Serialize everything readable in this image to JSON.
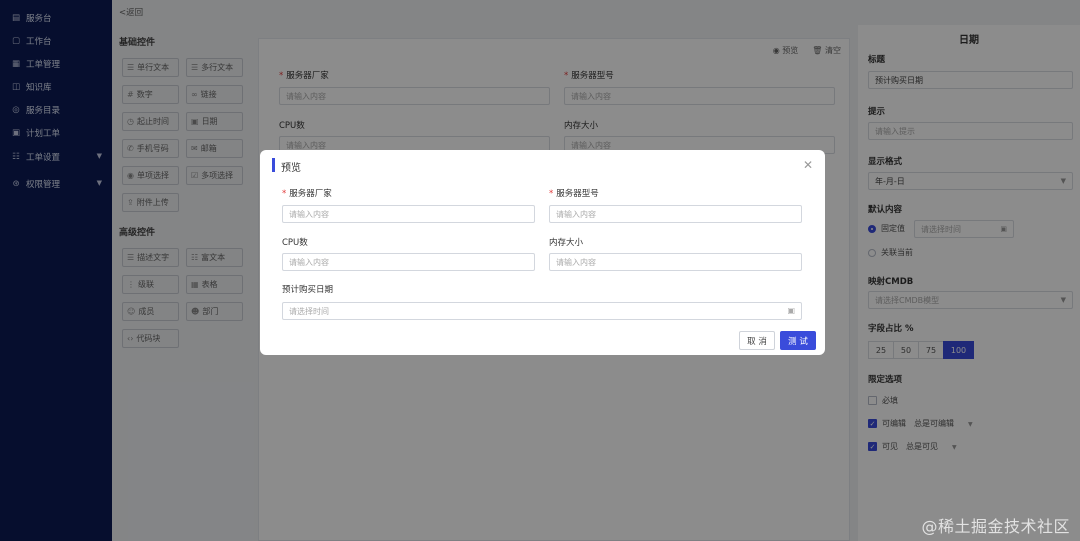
{
  "sidebar": {
    "items": [
      {
        "label": "服务台",
        "icon": "desk-icon"
      },
      {
        "label": "工作台",
        "icon": "workbench-icon"
      },
      {
        "label": "工单管理",
        "icon": "ticket-icon"
      },
      {
        "label": "知识库",
        "icon": "book-icon"
      },
      {
        "label": "服务目录",
        "icon": "catalog-icon"
      },
      {
        "label": "计划工单",
        "icon": "calendar-icon"
      },
      {
        "label": "工单设置",
        "icon": "settings-icon",
        "expandable": true
      },
      {
        "label": "权限管理",
        "icon": "shield-icon",
        "expandable": true
      }
    ]
  },
  "widgets": {
    "back_label": "返回",
    "basic_title": "基础控件",
    "basic": [
      "单行文本",
      "多行文本",
      "数字",
      "链接",
      "起止时间",
      "日期",
      "手机号码",
      "邮箱",
      "单项选择",
      "多项选择",
      "附件上传"
    ],
    "advanced_title": "高级控件",
    "advanced": [
      "描述文字",
      "富文本",
      "级联",
      "表格",
      "成员",
      "部门",
      "代码块"
    ]
  },
  "canvas": {
    "preview_label": "预览",
    "clear_label": "清空",
    "fields": [
      {
        "label": "服务器厂家",
        "required": true,
        "placeholder": "请输入内容"
      },
      {
        "label": "服务器型号",
        "required": true,
        "placeholder": "请输入内容"
      },
      {
        "label": "CPU数",
        "required": false,
        "placeholder": "请输入内容"
      },
      {
        "label": "内存大小",
        "required": false,
        "placeholder": "请输入内容"
      }
    ]
  },
  "props": {
    "title": "日期",
    "label_title": "标题",
    "title_value": "预计购买日期",
    "label_hint": "提示",
    "hint_placeholder": "请输入提示",
    "label_format": "显示格式",
    "format_value": "年-月-日",
    "label_default": "默认内容",
    "radio_fixed": "固定值",
    "fixed_placeholder": "请选择时间",
    "radio_current": "关联当前",
    "label_cmdb": "映射CMDB",
    "cmdb_placeholder": "请选择CMDB模型",
    "label_width": "字段占比 %",
    "width_options": [
      "25",
      "50",
      "75",
      "100"
    ],
    "width_selected": "100",
    "label_limits": "限定选项",
    "check_required": "必填",
    "check_editable": "可编辑",
    "editable_mode": "总是可编辑",
    "check_visible": "可见",
    "visible_mode": "总是可见"
  },
  "modal": {
    "title": "预览",
    "fields": [
      {
        "label": "服务器厂家",
        "required": true,
        "placeholder": "请输入内容"
      },
      {
        "label": "服务器型号",
        "required": true,
        "placeholder": "请输入内容"
      },
      {
        "label": "CPU数",
        "required": false,
        "placeholder": "请输入内容"
      },
      {
        "label": "内存大小",
        "required": false,
        "placeholder": "请输入内容"
      },
      {
        "label": "预计购买日期",
        "required": false,
        "placeholder": "请选择时间"
      }
    ],
    "cancel_label": "取 消",
    "ok_label": "测 试"
  },
  "watermark": "@稀土掘金技术社区",
  "colors": {
    "sidebar": "#0b1b55",
    "accent": "#3a4cdb",
    "required": "#e23b3b"
  }
}
